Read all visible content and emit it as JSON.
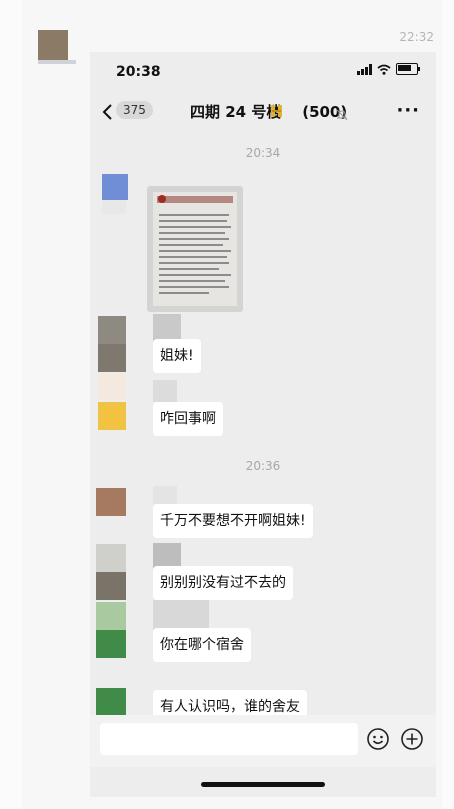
{
  "outer": {
    "time": "22:32"
  },
  "status": {
    "time": "20:38"
  },
  "nav": {
    "back_count": "375",
    "title": "四期 24 号楼    (500)"
  },
  "timestamps": {
    "first": "20:34",
    "second": "20:36"
  },
  "messages": [
    {
      "text": "姐妹!"
    },
    {
      "text": "咋回事啊"
    },
    {
      "text": "千万不要想不开啊姐妹!"
    },
    {
      "text": "别别别没有过不去的"
    },
    {
      "text": "你在哪个宿舍"
    },
    {
      "text": "有人认识吗，谁的舍友"
    }
  ],
  "colors": {
    "chat_bg": "#ededed",
    "bubble_bg": "#ffffff",
    "avatar_blue": "#6f8ed6",
    "avatar_gray": "#7e786e",
    "avatar_yellow": "#f2c343",
    "avatar_brown": "#a57a60",
    "avatar_green": "#3f8b47"
  },
  "icons": [
    "chevron-left-icon",
    "signal-icon",
    "wifi-icon",
    "battery-icon",
    "mute-icon",
    "more-icon",
    "emoji-icon",
    "plus-icon"
  ]
}
